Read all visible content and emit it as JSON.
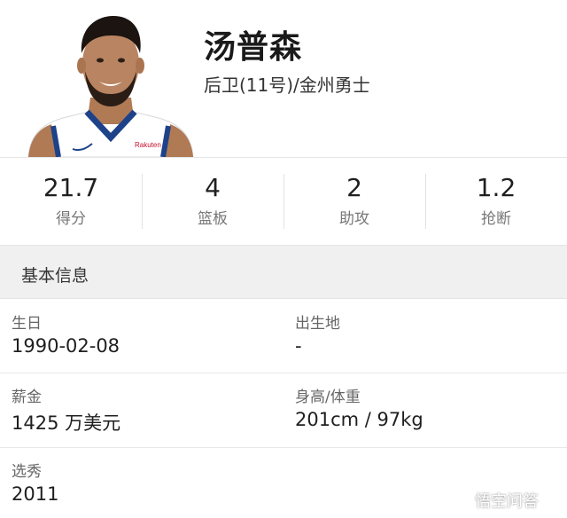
{
  "player": {
    "name": "汤普森",
    "position_team": "后卫(11号)/金州勇士"
  },
  "stats": [
    {
      "value": "21.7",
      "label": "得分"
    },
    {
      "value": "4",
      "label": "篮板"
    },
    {
      "value": "2",
      "label": "助攻"
    },
    {
      "value": "1.2",
      "label": "抢断"
    }
  ],
  "section": {
    "title": "基本信息"
  },
  "info": {
    "birthday": {
      "label": "生日",
      "value": "1990-02-08"
    },
    "birthplace": {
      "label": "出生地",
      "value": "-"
    },
    "salary": {
      "label": "薪金",
      "value": "1425 万美元"
    },
    "height_weight": {
      "label": "身高/体重",
      "value": "201cm / 97kg"
    },
    "draft": {
      "label": "选秀",
      "value": "2011"
    }
  },
  "photo": {
    "jersey_text": "Rakuten"
  },
  "watermark": {
    "text": "悟空问答"
  },
  "colors": {
    "jersey_blue": "#1d428a",
    "jersey_white": "#ffffff",
    "section_bg": "#f0f0f0"
  }
}
